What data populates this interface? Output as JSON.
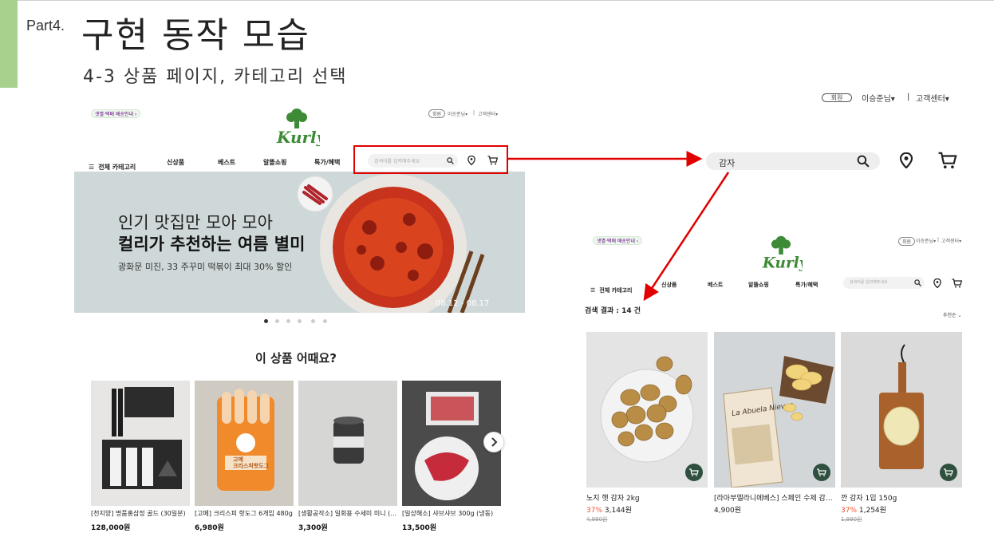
{
  "slide": {
    "part_label": "Part4.",
    "title": "구현 동작 모습",
    "subtitle": "4-3 상품 페이지, 카테고리 선택"
  },
  "left_site": {
    "delivery_badge": "샛별·택배 배송안내 ›",
    "join": "회원",
    "user": "이승준님▾",
    "sep": "|",
    "cs": "고객센터▾",
    "logo": "Kurly",
    "nav": {
      "all": "전체 카테고리",
      "items": [
        "신상품",
        "베스트",
        "알뜰쇼핑",
        "특가/혜택"
      ]
    },
    "search_placeholder": "검색어를 입력해주세요",
    "banner": {
      "line1": "인기 맛집만 모아 모아",
      "line2": "컬리가 추천하는 여름 별미",
      "line3": "광화문 미진, 33 주꾸미 떡볶이 최대 30% 할인",
      "date": "08.12 - 08.17"
    },
    "section_title": "이 상품 어때요?",
    "products": [
      {
        "name": "[천지양] 명품홍삼정 골드 (30일분)",
        "price": "128,000원"
      },
      {
        "name": "[고메] 크리스피 핫도그 6개입 480g",
        "price": "6,980원"
      },
      {
        "name": "[생활공작소] 일회용 수세미 미니 (…",
        "price": "3,300원"
      },
      {
        "name": "[일상해소] 샤브샤브 300g (냉동)",
        "price": "13,500원"
      }
    ],
    "pack_label": "고메\n크리스피핫도그"
  },
  "right_header": {
    "join": "회원",
    "user": "이승준님▾",
    "sep": "|",
    "cs": "고객센터▾",
    "search_value": "감자"
  },
  "result_site": {
    "delivery_badge": "샛별·택배 배송안내 ›",
    "join": "회원",
    "user": "이승준님▾",
    "sep": "|",
    "cs": "고객센터▾",
    "logo": "Kurly",
    "nav": {
      "all": "전체 카테고리",
      "items": [
        "신상품",
        "베스트",
        "알뜰쇼핑",
        "특가/혜택"
      ]
    },
    "search_placeholder": "검색어를 입력해주세요",
    "result_title": "검색 결과 : 14 건",
    "sort": "추천순 ⌄",
    "products": [
      {
        "name": "노지 햇 감자 2kg",
        "discount": "37%",
        "price": "3,144원",
        "original": "4,990원"
      },
      {
        "name": "[라아부엘라니에베스] 스페인 수제 감…",
        "discount": "",
        "price": "4,900원",
        "original": ""
      },
      {
        "name": "깐 감자 1입 150g",
        "discount": "37%",
        "price": "1,254원",
        "original": "1,990원"
      }
    ]
  },
  "colors": {
    "accent_green": "#a9d18e",
    "kurly_green": "#3d8b37",
    "highlight_red": "#e00000",
    "discount": "#f0512d"
  }
}
